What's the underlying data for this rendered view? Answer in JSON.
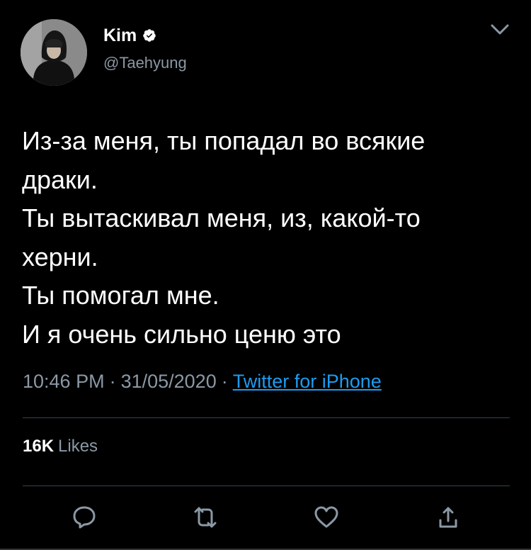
{
  "author": {
    "name": "Kim",
    "handle": "@Taehyung",
    "verified": true
  },
  "tweet": {
    "lines": [
      "Из-за меня, ты попадал во всякие",
      "драки.",
      "Ты вытаскивал меня, из, какой-то",
      "херни.",
      "Ты помогал мне.",
      "И я очень сильно ценю это"
    ]
  },
  "meta": {
    "time": "10:46 PM",
    "separator": "·",
    "date": "31/05/2020",
    "source": "Twitter for iPhone"
  },
  "stats": {
    "likes_count": "16K",
    "likes_label": "Likes"
  },
  "icons": {
    "more": "chevron-down-icon",
    "reply": "reply-icon",
    "retweet": "retweet-icon",
    "like": "heart-icon",
    "share": "share-icon",
    "verified": "verified-badge-icon"
  },
  "colors": {
    "background": "#000000",
    "text": "#ffffff",
    "secondary_text": "#8b98a5",
    "link": "#1d9bf0",
    "icon": "#8b98a5"
  }
}
